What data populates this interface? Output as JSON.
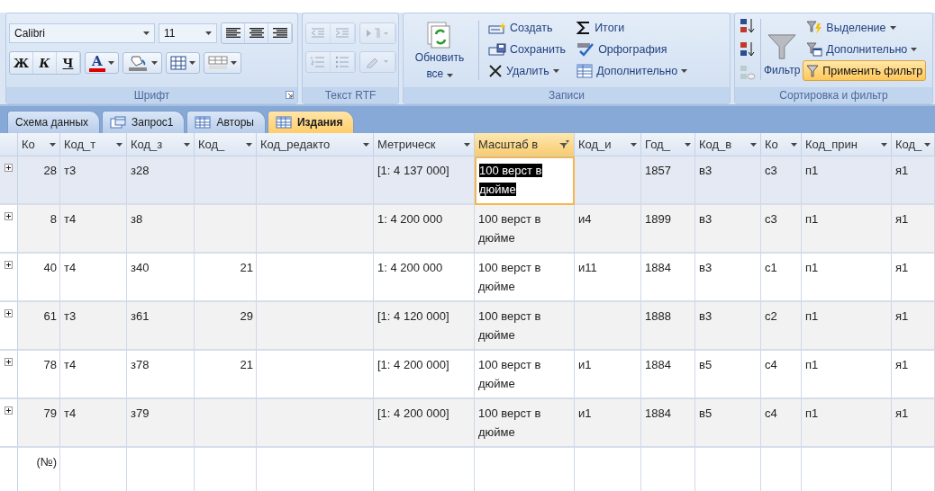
{
  "font_group": {
    "label": "Шрифт",
    "font": "Calibri",
    "size": "11",
    "bold": "Ж",
    "italic": "К",
    "underline": "Ч",
    "font_color": "A"
  },
  "rtf_group": {
    "label": "Текст RTF",
    "disabled": true
  },
  "records_group": {
    "label": "Записи",
    "refresh": "Обновить все",
    "buttons": [
      {
        "label": "Создать",
        "kind": "new",
        "dropdown": false
      },
      {
        "label": "Сохранить",
        "kind": "save",
        "dropdown": false
      },
      {
        "label": "Удалить",
        "kind": "delete",
        "dropdown": true
      },
      {
        "label": "Итоги",
        "kind": "totals",
        "dropdown": false
      },
      {
        "label": "Орфография",
        "kind": "spelling",
        "dropdown": false
      },
      {
        "label": "Дополнительно",
        "kind": "more",
        "dropdown": true
      }
    ]
  },
  "sort_group": {
    "label": "Сортировка и фильтр",
    "filter": "Фильтр",
    "buttons": [
      {
        "label": "Выделение",
        "kind": "selection",
        "dropdown": true,
        "on": false
      },
      {
        "label": "Дополнительно",
        "kind": "advanced",
        "dropdown": true,
        "on": false
      },
      {
        "label": "Применить фильтр",
        "kind": "apply",
        "dropdown": false,
        "on": true
      }
    ]
  },
  "tabs": [
    {
      "label": "Схема данных",
      "kind": "relationships",
      "selected": false
    },
    {
      "label": "Запрос1",
      "kind": "query",
      "selected": false
    },
    {
      "label": "Авторы",
      "kind": "table",
      "selected": false
    },
    {
      "label": "Издания",
      "kind": "table",
      "selected": true
    }
  ],
  "table": {
    "columns": [
      {
        "label": "Ко",
        "kind": "number",
        "selected": false,
        "filtered": false
      },
      {
        "label": "Код_т",
        "kind": "text",
        "selected": false,
        "filtered": false
      },
      {
        "label": "Код_з",
        "kind": "text",
        "selected": false,
        "filtered": false
      },
      {
        "label": "Код_",
        "kind": "number",
        "selected": false,
        "filtered": false
      },
      {
        "label": "Код_редакто",
        "kind": "text",
        "selected": false,
        "filtered": false
      },
      {
        "label": "Метрическ",
        "kind": "text",
        "selected": false,
        "filtered": false
      },
      {
        "label": "Масштаб в",
        "kind": "text",
        "selected": true,
        "filtered": true
      },
      {
        "label": "Код_и",
        "kind": "text",
        "selected": false,
        "filtered": false
      },
      {
        "label": "Год_",
        "kind": "text",
        "selected": false,
        "filtered": false
      },
      {
        "label": "Код_в",
        "kind": "text",
        "selected": false,
        "filtered": false
      },
      {
        "label": "Ко",
        "kind": "text",
        "selected": false,
        "filtered": false
      },
      {
        "label": "Код_прин",
        "kind": "text",
        "selected": false,
        "filtered": false
      },
      {
        "label": "Код_",
        "kind": "text",
        "selected": false,
        "filtered": false
      }
    ],
    "rows": [
      {
        "selected": true,
        "cells": [
          "28",
          "т3",
          "з28",
          null,
          null,
          "[1: 4 137 000]",
          "100 верст в дюйме",
          null,
          "1857",
          "в3",
          "с3",
          "п1",
          "я1"
        ]
      },
      {
        "selected": false,
        "cells": [
          "8",
          "т4",
          "з8",
          null,
          null,
          "1: 4 200 000",
          "100 верст в дюйме",
          "и4",
          "1899",
          "в3",
          "с3",
          "п1",
          "я1"
        ]
      },
      {
        "selected": false,
        "cells": [
          "40",
          "т4",
          "з40",
          "21",
          null,
          "1: 4 200 000",
          "100 верст в дюйме",
          "и11",
          "1884",
          "в3",
          "с1",
          "п1",
          "я1"
        ]
      },
      {
        "selected": false,
        "cells": [
          "61",
          "т3",
          "з61",
          "29",
          null,
          "[1: 4 120 000]",
          "100 верст в дюйме",
          null,
          "1888",
          "в3",
          "с2",
          "п1",
          "я1"
        ]
      },
      {
        "selected": false,
        "cells": [
          "78",
          "т4",
          "з78",
          "21",
          null,
          "[1: 4 200 000]",
          "100 верст в дюйме",
          "и1",
          "1884",
          "в5",
          "с4",
          "п1",
          "я1"
        ]
      },
      {
        "selected": false,
        "cells": [
          "79",
          "т4",
          "з79",
          null,
          null,
          "[1: 4 200 000]",
          "100 верст в дюйме",
          "и1",
          "1884",
          "в5",
          "с4",
          "п1",
          "я1"
        ]
      }
    ],
    "new_row": "(№)"
  }
}
